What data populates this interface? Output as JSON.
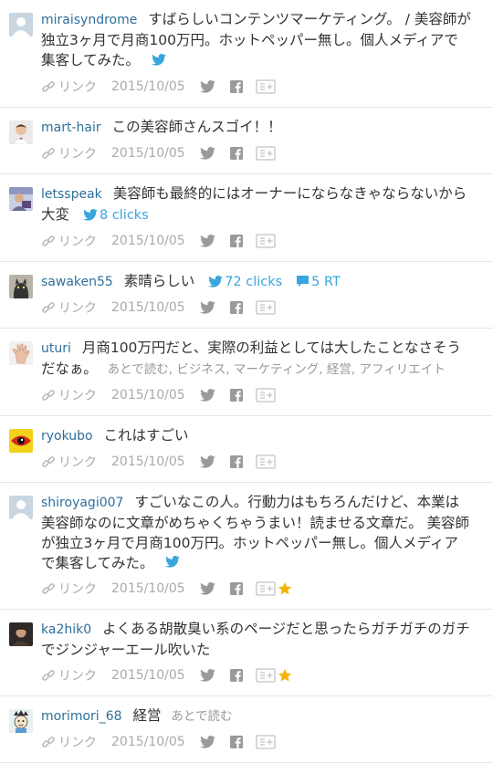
{
  "colors": {
    "username": "#2d6f9c",
    "twitter": "#3aa5de",
    "meta": "#aaaaaa",
    "star": "#f5b400"
  },
  "comments": [
    {
      "avatar_icon": "default-avatar-icon",
      "user": "miraisyndrome",
      "text": "すばらしいコンテンツマーケティング。 / 美容師が独立3ヶ月で月商100万円。ホットペッパー無し。個人メディアで集客してみた。",
      "link_label": "リンク",
      "date": "2015/10/05"
    },
    {
      "avatar_icon": "user-photo-avatar-icon",
      "user": "mart-hair",
      "text": "この美容師さんスゴイ！！",
      "link_label": "リンク",
      "date": "2015/10/05"
    },
    {
      "avatar_icon": "user-photo-avatar-icon",
      "user": "letsspeak",
      "text": "美容師も最終的にはオーナーにならなきゃならないから大変",
      "clicks": "8 clicks",
      "link_label": "リンク",
      "date": "2015/10/05"
    },
    {
      "avatar_icon": "cat-avatar-icon",
      "user": "sawaken55",
      "text": "素晴らしい",
      "clicks": "72 clicks",
      "rt": "5 RT",
      "link_label": "リンク",
      "date": "2015/10/05"
    },
    {
      "avatar_icon": "hand-avatar-icon",
      "user": "uturi",
      "text": "月商100万円だと、実際の利益としては大したことなさそうだなぁ。",
      "tags": "あとで読む, ビジネス, マーケティング, 経営, アフィリエイト",
      "link_label": "リンク",
      "date": "2015/10/05"
    },
    {
      "avatar_icon": "red-eye-avatar-icon",
      "user": "ryokubo",
      "text": "これはすごい",
      "link_label": "リンク",
      "date": "2015/10/05"
    },
    {
      "avatar_icon": "default-avatar-icon",
      "user": "shiroyagi007",
      "text": "すごいなこの人。行動力はもちろんだけど、本業は美容師なのに文章がめちゃくちゃうまい！読ませる文章だ。 美容師が独立3ヶ月で月商100万円。ホットペッパー無し。個人メディアで集客してみた。",
      "link_label": "リンク",
      "date": "2015/10/05"
    },
    {
      "avatar_icon": "user-photo-avatar-icon",
      "user": "ka2hik0",
      "text": "よくある胡散臭い系のページだと思ったらガチガチのガチでジンジャーエール吹いた",
      "link_label": "リンク",
      "date": "2015/10/05"
    },
    {
      "avatar_icon": "cartoon-avatar-icon",
      "user": "morimori_68",
      "text": "経営",
      "tags": "あとで読む",
      "link_label": "リンク",
      "date": "2015/10/05"
    }
  ]
}
